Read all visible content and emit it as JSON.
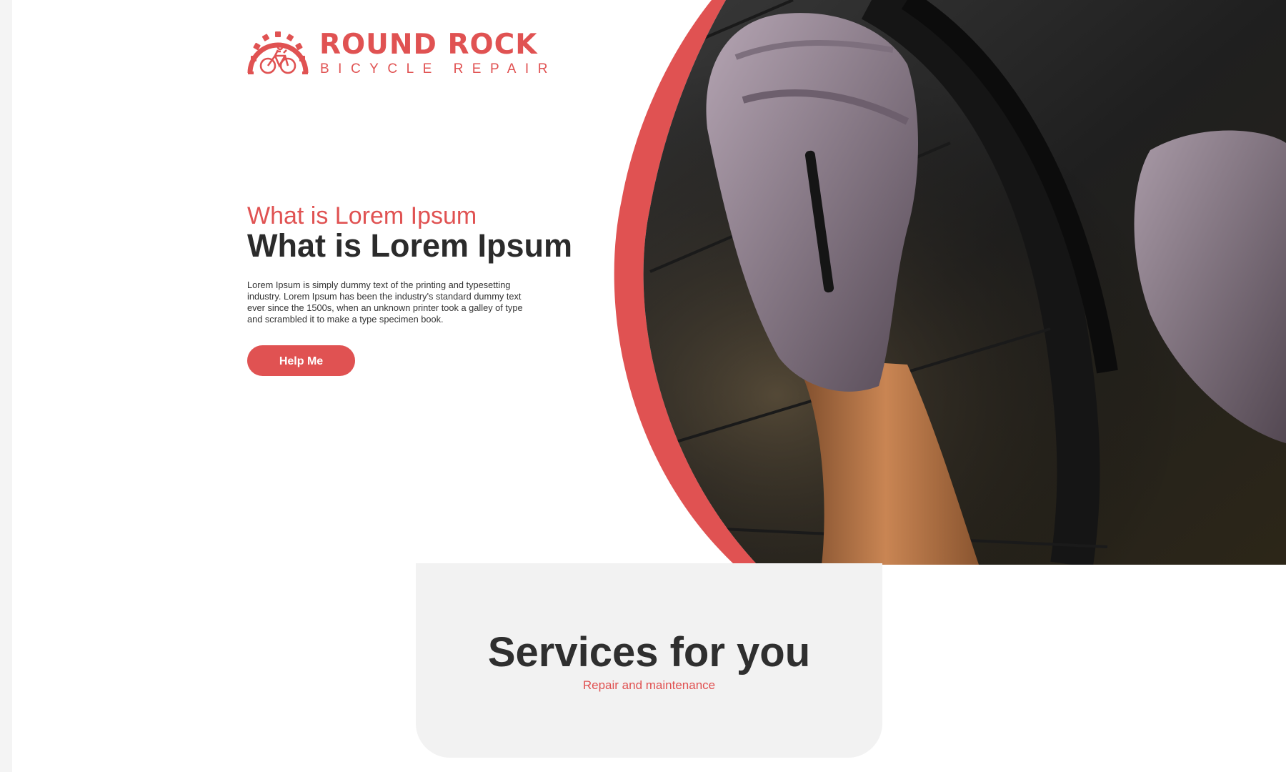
{
  "brand": {
    "title": "ROUND ROCK",
    "subtitle": "BICYCLE REPAIR",
    "logo_icon": "bicycle-gear-icon"
  },
  "hero": {
    "subheading": "What is Lorem Ipsum",
    "heading": "What is Lorem Ipsum",
    "body": "Lorem Ipsum is simply dummy text of the printing and typesetting industry. Lorem Ipsum has been the industry's standard dummy text ever since the 1500s, when an unknown printer took a galley of type and scrambled it to make a type specimen book.",
    "button_label": "Help Me",
    "image_subject": "gloved-hands-repairing-bicycle-wheel"
  },
  "services": {
    "title": "Services for you",
    "subtitle": "Repair and maintenance"
  },
  "colors": {
    "accent": "#e05252",
    "heading": "#2b2b2b",
    "card_bg": "#f2f2f2"
  }
}
